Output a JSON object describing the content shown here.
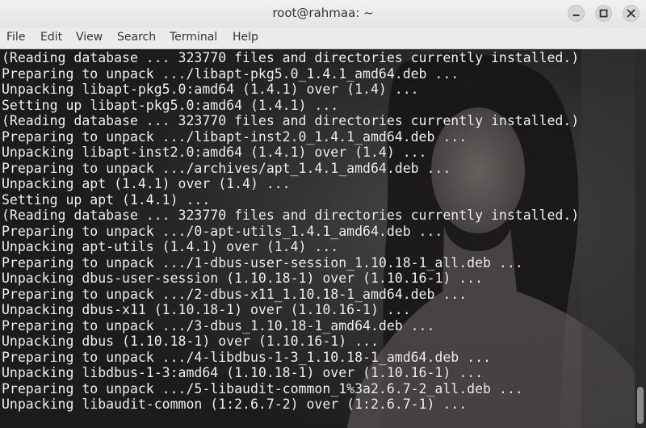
{
  "window": {
    "title": "root@rahmaa: ~"
  },
  "menu": {
    "items": [
      "File",
      "Edit",
      "View",
      "Search",
      "Terminal",
      "Help"
    ]
  },
  "terminal": {
    "lines": [
      "(Reading database ... 323770 files and directories currently installed.)",
      "Preparing to unpack .../libapt-pkg5.0_1.4.1_amd64.deb ...",
      "Unpacking libapt-pkg5.0:amd64 (1.4.1) over (1.4) ...",
      "Setting up libapt-pkg5.0:amd64 (1.4.1) ...",
      "(Reading database ... 323770 files and directories currently installed.)",
      "Preparing to unpack .../libapt-inst2.0_1.4.1_amd64.deb ...",
      "Unpacking libapt-inst2.0:amd64 (1.4.1) over (1.4) ...",
      "Preparing to unpack .../archives/apt_1.4.1_amd64.deb ...",
      "Unpacking apt (1.4.1) over (1.4) ...",
      "Setting up apt (1.4.1) ...",
      "(Reading database ... 323770 files and directories currently installed.)",
      "Preparing to unpack .../0-apt-utils_1.4.1_amd64.deb ...",
      "Unpacking apt-utils (1.4.1) over (1.4) ...",
      "Preparing to unpack .../1-dbus-user-session_1.10.18-1_all.deb ...",
      "Unpacking dbus-user-session (1.10.18-1) over (1.10.16-1) ...",
      "Preparing to unpack .../2-dbus-x11_1.10.18-1_amd64.deb ...",
      "Unpacking dbus-x11 (1.10.18-1) over (1.10.16-1) ...",
      "Preparing to unpack .../3-dbus_1.10.18-1_amd64.deb ...",
      "Unpacking dbus (1.10.18-1) over (1.10.16-1) ...",
      "Preparing to unpack .../4-libdbus-1-3_1.10.18-1_amd64.deb ...",
      "Unpacking libdbus-1-3:amd64 (1.10.18-1) over (1.10.16-1) ...",
      "Preparing to unpack .../5-libaudit-common_1%3a2.6.7-2_all.deb ...",
      "Unpacking libaudit-common (1:2.6.7-2) over (1:2.6.7-1) ..."
    ]
  },
  "icons": {
    "minimize": "minimize-icon",
    "maximize": "maximize-icon",
    "close": "close-icon"
  },
  "colors": {
    "terminal_text": "#f2f2f2",
    "terminal_bg": "#222222",
    "titlebar_bg": "#e8e8e8"
  }
}
